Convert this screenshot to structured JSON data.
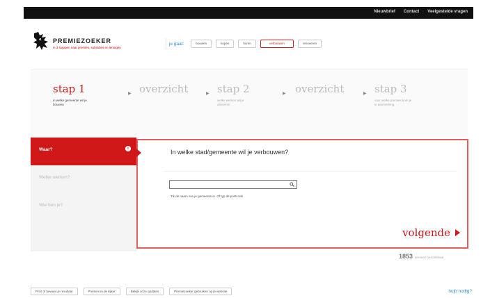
{
  "topbar": {
    "links": [
      "Nieuwbrief",
      "Contact",
      "Veelgestelde vragen"
    ]
  },
  "logo": {
    "brand": "PREMIEZOEKER",
    "subtitle": "in 3 stappen naar premies, subsidies en leningen"
  },
  "nav": {
    "label": "je gaat:",
    "options": [
      "bouwen",
      "kopen",
      "huren",
      "verbouwen",
      "renoveren"
    ],
    "active_index": 3
  },
  "steps": [
    {
      "title": "stap 1",
      "desc": "in welke gemeente wil je bouwen",
      "active": true
    },
    {
      "title": "overzicht",
      "desc": "",
      "active": false
    },
    {
      "title": "stap 2",
      "desc": "welke werken wil je uitvoeren",
      "active": false
    },
    {
      "title": "overzicht",
      "desc": "",
      "active": false
    },
    {
      "title": "stap 3",
      "desc": "voor welke premies kom je in aanmerking",
      "active": false
    }
  ],
  "sidebar": {
    "items": [
      {
        "label": "Waar?",
        "active": true,
        "info": "i"
      },
      {
        "label": "Welke werken?",
        "active": false
      },
      {
        "label": "Wie ben je?",
        "active": false
      }
    ]
  },
  "form": {
    "question": "In welke stad/gemeente wil je verbouwen?",
    "input_value": "",
    "input_placeholder": "",
    "hint": "Tik de naam van je gemeente in. Of typ de postcode",
    "next_label": "volgende"
  },
  "counter": {
    "number": "1853",
    "label": "premies beschikbaar"
  },
  "footer": {
    "buttons": [
      "Print of bewaar je resultaat",
      "Premies in de kijker",
      "Bekijk onze updates",
      "Premiezoeker gebruiken op je website"
    ],
    "help": "hulp nodig?"
  },
  "colors": {
    "accent": "#d01818",
    "link": "#2a8ad4"
  }
}
